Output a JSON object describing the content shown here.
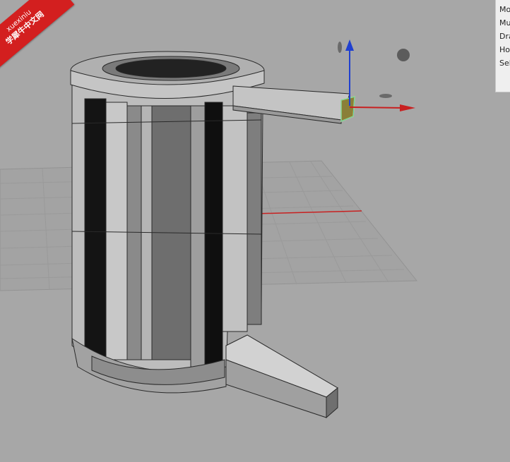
{
  "watermark": {
    "line1": "xuexiniu",
    "line2": "学犀牛中文网",
    "color": "#d31f1f"
  },
  "hud_panel": {
    "items": [
      {
        "label": "Mo"
      },
      {
        "label": "Mu"
      },
      {
        "label": "Dra"
      },
      {
        "label": "Ho"
      },
      {
        "label": "Sel"
      }
    ]
  },
  "viewport": {
    "background": "#a7a7a7",
    "grid_color": "#8f8f8f",
    "x_axis_color": "#d02020",
    "z_axis_color": "#2040d0",
    "selection_color": "#e8e050",
    "gizmo_icons": [
      "move-z-arrow-icon",
      "move-x-arrow-icon",
      "rotate-handle-icon",
      "scale-handle-icon"
    ]
  }
}
